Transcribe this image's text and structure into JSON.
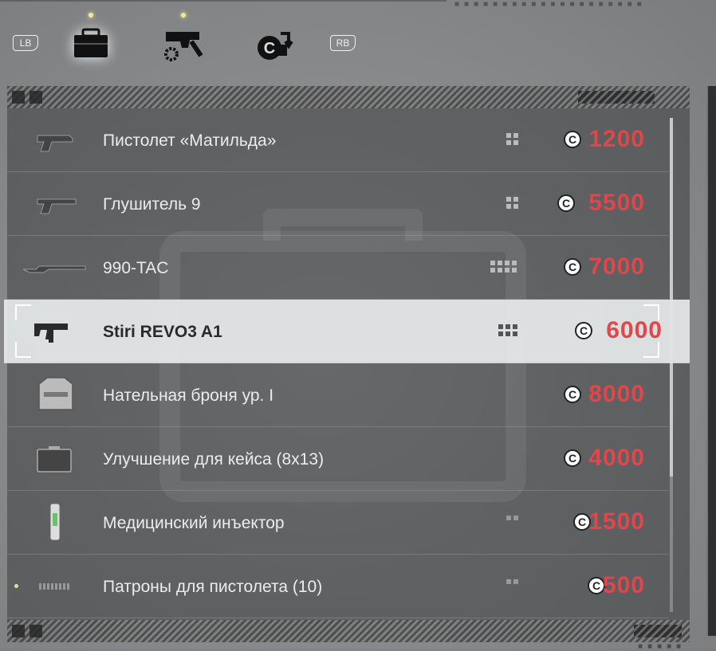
{
  "header": {
    "lb_label": "LB",
    "rb_label": "RB",
    "tabs": [
      {
        "icon": "briefcase-icon",
        "active": true,
        "has_notice": true
      },
      {
        "icon": "gun-upgrade-icon",
        "active": false,
        "has_notice": true
      },
      {
        "icon": "currency-exchange-icon",
        "active": false,
        "has_notice": false
      }
    ]
  },
  "colors": {
    "price": "#e0464a",
    "selected_row": "#e6e8ea",
    "text": "#ececec"
  },
  "items": [
    {
      "name": "Пистолет «Матильда»",
      "price": "1200",
      "icon": "pistol-icon"
    },
    {
      "name": "Глушитель 9",
      "price": "5500",
      "icon": "silenced-pistol-icon"
    },
    {
      "name": "990-TAC",
      "price": "7000",
      "icon": "rifle-icon"
    },
    {
      "name": "Stiri REVO3 A1",
      "price": "6000",
      "icon": "smg-icon",
      "selected": true
    },
    {
      "name": "Нательная броня ур. I",
      "price": "8000",
      "icon": "body-armor-icon"
    },
    {
      "name": "Улучшение для кейса (8x13)",
      "price": "4000",
      "icon": "case-icon"
    },
    {
      "name": "Медицинский инъектор",
      "price": "1500",
      "icon": "injector-icon"
    },
    {
      "name": "Патроны для пистолета (10)",
      "price": "500",
      "icon": "ammo-icon"
    }
  ]
}
